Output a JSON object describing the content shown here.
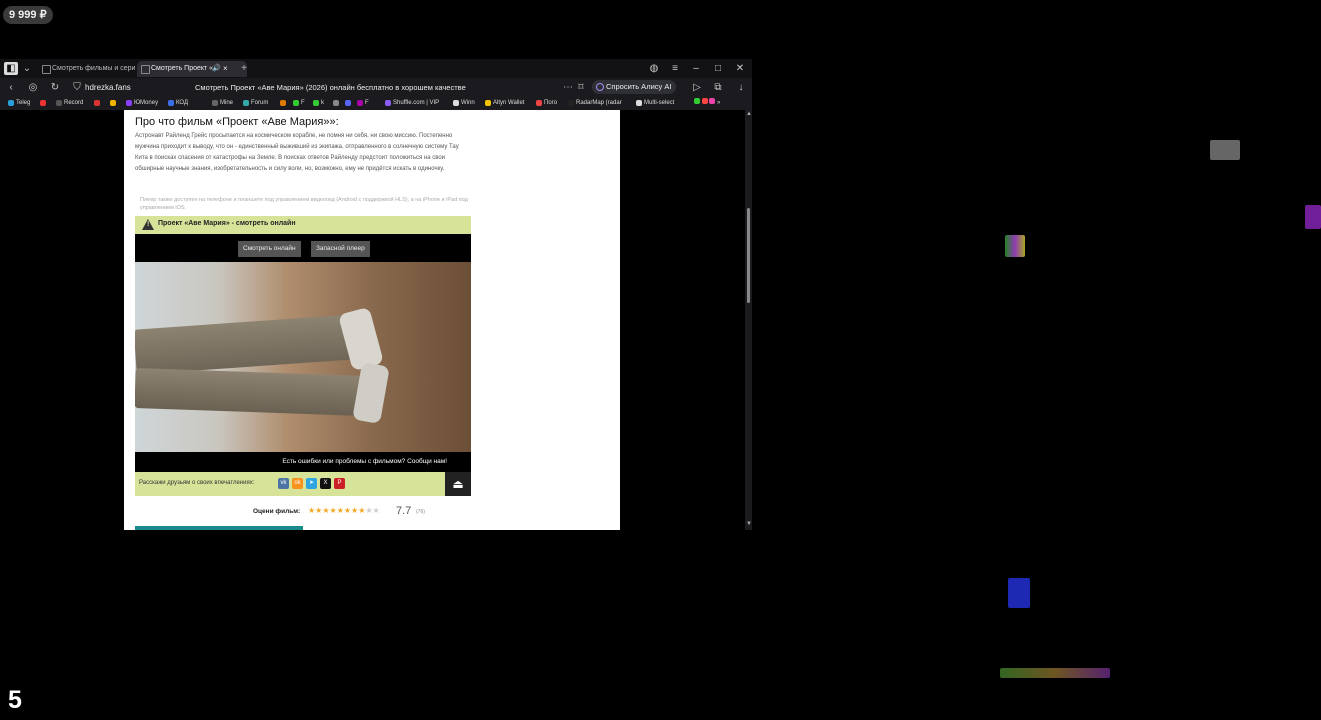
{
  "overlay": {
    "balance": "9 999 ₽",
    "bottom_number": "5"
  },
  "browser": {
    "tabs": [
      {
        "label": "Смотреть фильмы и сери",
        "active": false
      },
      {
        "label": "Смотреть Проект «",
        "active": true
      }
    ],
    "address": {
      "site": "hdrezka.fans",
      "page_title": "Смотреть Проект «Аве Мария» (2026) онлайн бесплатно в хорошем качестве",
      "alice_label": "Спросить Алису AI"
    },
    "bookmarks": [
      {
        "label": "Teleg",
        "color": "#29a0da"
      },
      {
        "label": "",
        "color": "#e33"
      },
      {
        "label": "Record",
        "color": "#333"
      },
      {
        "label": "",
        "color": "#d33"
      },
      {
        "label": "",
        "color": "#f5b400"
      },
      {
        "label": "ЮMoney",
        "color": "#8b3ffd"
      },
      {
        "label": "КОД",
        "color": "#3a6ee8"
      },
      {
        "label": "Mine",
        "color": "#666"
      },
      {
        "label": "Forum",
        "color": "#3aa"
      },
      {
        "label": "",
        "color": "#e07a00"
      },
      {
        "label": "F",
        "color": "#3c3"
      },
      {
        "label": "k",
        "color": "#3c3"
      },
      {
        "label": "",
        "color": "#888"
      },
      {
        "label": "",
        "color": "#5865f2"
      },
      {
        "label": "F",
        "color": "#a0a"
      },
      {
        "label": "Shuffle.com | VIP",
        "color": "#8b5cf6"
      },
      {
        "label": "Winn",
        "color": "#ddd"
      },
      {
        "label": "Altyn Wallet",
        "color": "#f5c400"
      },
      {
        "label": "Пого",
        "color": "#e44"
      },
      {
        "label": "RadarMap (radar",
        "color": "#222"
      },
      {
        "label": "Multi-select",
        "color": "#ddd"
      }
    ]
  },
  "page": {
    "heading": "Про что фильм «Проект «Аве Мария»»:",
    "description": "Астронавт Райленд Грейс просыпается на космическом корабле, не помня ни себя, ни свою миссию. Постепенно мужчина приходит к выводу, что он - единственный выживший из экипажа, отправленного в солнечную систему Тау Кита в поисках спасения от катастрофы на Земле. В поисках ответов Райленду предстоит положиться на свои обширные научные знания, изобретательность и силу воли, но, возможно, ему не придётся искать в одиночку.",
    "player_note": "Плеер также доступен на телефоне и планшете под управлением видеоокд (Android с поддержкой HLS), а на iPhone и iPad под управлением iOS.",
    "player": {
      "title": "Проект «Аве Мария» - смотреть онлайн",
      "watch_button": "Смотреть онлайн",
      "backup_button": "Запасной плеер",
      "report_text": "Есть ошибки или проблемы с фильмом? Сообщи нам!",
      "watermark": "",
      "share_label": "Расскажи друзьям о своих впечатлениях:",
      "social": [
        {
          "label": "vk",
          "color": "#4c75a3"
        },
        {
          "label": "ok",
          "color": "#f7931e"
        },
        {
          "label": "tg",
          "color": "#2ca5e0"
        },
        {
          "label": "X",
          "color": "#111111"
        },
        {
          "label": "P",
          "color": "#cb2027"
        }
      ]
    },
    "rating": {
      "label": "Оцени фильм:",
      "value": "7.7",
      "count": "(76)",
      "stars_filled": 8,
      "stars_total": 10
    }
  }
}
